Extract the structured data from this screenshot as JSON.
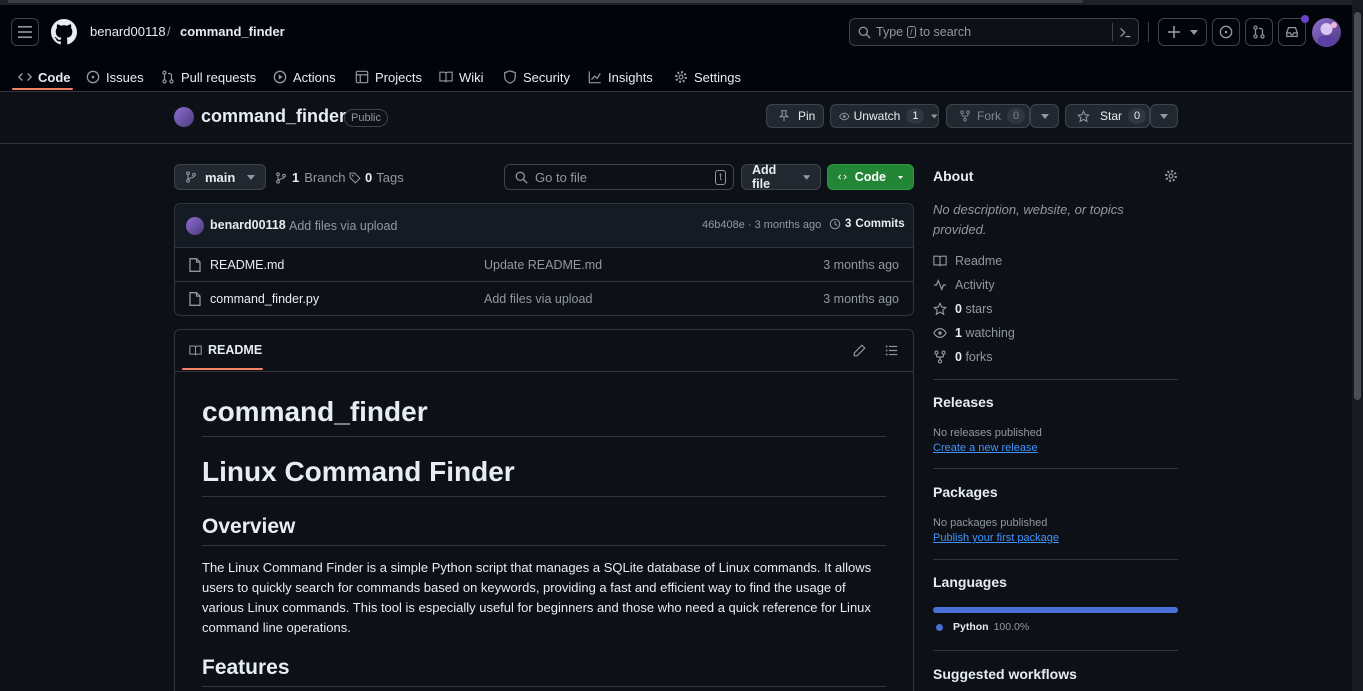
{
  "header": {
    "owner": "benard00118",
    "separator": "/",
    "repo": "command_finder",
    "search_placeholder_prefix": "Type",
    "search_key": "/",
    "search_placeholder_suffix": "to search"
  },
  "tabs": [
    {
      "label": "Code"
    },
    {
      "label": "Issues"
    },
    {
      "label": "Pull requests"
    },
    {
      "label": "Actions"
    },
    {
      "label": "Projects"
    },
    {
      "label": "Wiki"
    },
    {
      "label": "Security"
    },
    {
      "label": "Insights"
    },
    {
      "label": "Settings"
    }
  ],
  "repo_head": {
    "name": "command_finder",
    "visibility": "Public",
    "pin_label": "Pin",
    "watch_label": "Unwatch",
    "watch_count": "1",
    "fork_label": "Fork",
    "fork_count": "0",
    "star_label": "Star",
    "star_count": "0"
  },
  "branch_bar": {
    "branch": "main",
    "branch_count": "1",
    "branch_label": "Branch",
    "tag_count": "0",
    "tag_label": "Tags",
    "goto_placeholder": "Go to file",
    "goto_key": "t",
    "add_file_label": "Add file",
    "code_label": "Code"
  },
  "latest_commit": {
    "author": "benard00118",
    "message": "Add files via upload",
    "hash_time": "46b408e · 3 months ago",
    "commits_count": "3",
    "commits_label": "Commits"
  },
  "files": [
    {
      "name": "README.md",
      "message": "Update README.md",
      "time": "3 months ago"
    },
    {
      "name": "command_finder.py",
      "message": "Add files via upload",
      "time": "3 months ago"
    }
  ],
  "readme": {
    "tab_label": "README",
    "h1_title": "command_finder",
    "h1_subtitle": "Linux Command Finder",
    "overview_heading": "Overview",
    "overview_text": "The Linux Command Finder is a simple Python script that manages a SQLite database of Linux commands. It allows users to quickly search for commands based on keywords, providing a fast and efficient way to find the usage of various Linux commands. This tool is especially useful for beginners and those who need a quick reference for Linux command line operations.",
    "features_heading": "Features"
  },
  "about": {
    "heading": "About",
    "description": "No description, website, or topics provided.",
    "readme_label": "Readme",
    "activity_label": "Activity",
    "stars_count": "0",
    "stars_label": "stars",
    "watching_count": "1",
    "watching_label": "watching",
    "forks_count": "0",
    "forks_label": "forks"
  },
  "releases": {
    "heading": "Releases",
    "text": "No releases published",
    "link": "Create a new release"
  },
  "packages": {
    "heading": "Packages",
    "text": "No packages published",
    "link": "Publish your first package"
  },
  "languages": {
    "heading": "Languages",
    "items": [
      {
        "name": "Python",
        "percent": "100.0%",
        "fraction": 1.0,
        "color": "#3572A5"
      }
    ]
  },
  "suggested": {
    "heading": "Suggested workflows"
  },
  "colors": {
    "accent_tab": "#f78166",
    "code_button": "#238636",
    "link": "#4493f8",
    "python": "#3572A5"
  }
}
